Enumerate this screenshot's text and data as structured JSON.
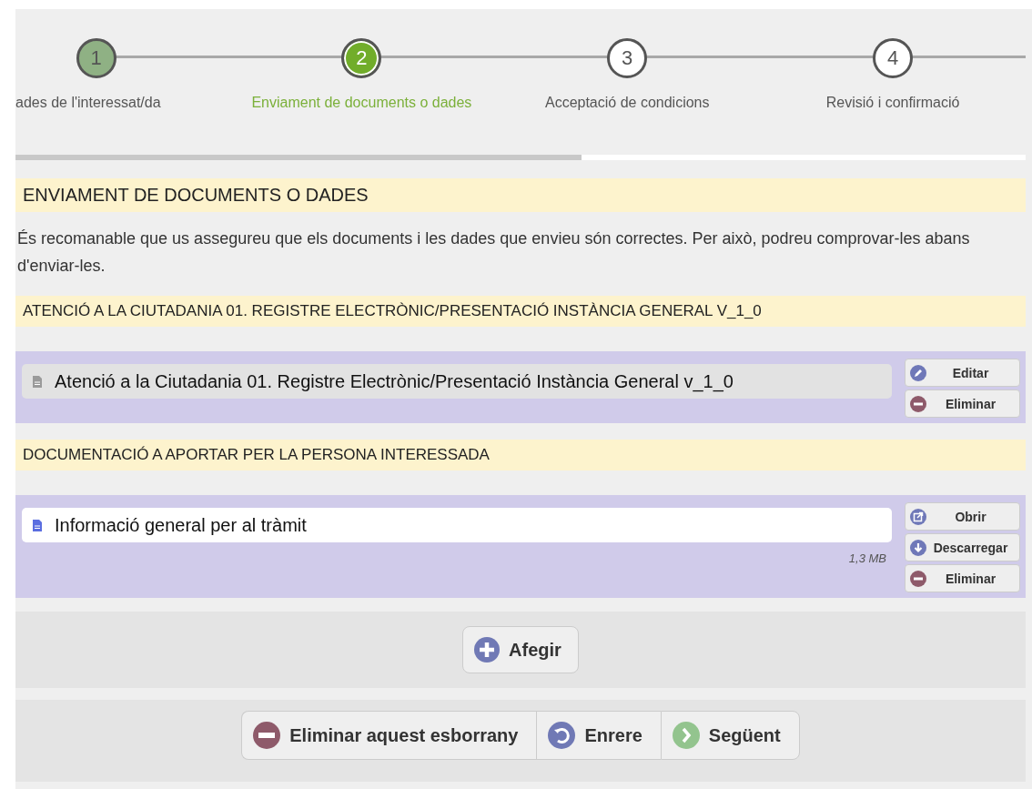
{
  "steps": [
    {
      "number": "1",
      "label": "ades de l'interessat/da",
      "completed": true,
      "selected": false
    },
    {
      "number": "2",
      "label": "Enviament de documents o dades",
      "completed": false,
      "selected": true
    },
    {
      "number": "3",
      "label": "Acceptació de condicions",
      "completed": false,
      "selected": false
    },
    {
      "number": "4",
      "label": "Revisió i confirmació",
      "completed": false,
      "selected": false
    }
  ],
  "progress": {
    "level": 0.56
  },
  "heading": "ENVIAMENT DE DOCUMENTS O DADES",
  "intro": "És recomanable que us assegureu que els documents i les dades que envieu són correctes. Per això, podreu comprovar-les abans d'enviar-les.",
  "sections": [
    {
      "title": "ATENCIÓ A LA CIUTADANIA 01. REGISTRE ELECTRÒNIC/PRESENTACIÓ INSTÀNCIA GENERAL V_1_0",
      "items": [
        {
          "kind": "form",
          "name": "Atenció a la Ciutadania 01. Registre Electrònic/Presentació Instància General v_1_0",
          "actions": [
            {
              "kind": "edit",
              "label": "Editar"
            },
            {
              "kind": "delete",
              "label": "Eliminar"
            }
          ]
        }
      ]
    },
    {
      "title": "DOCUMENTACIÓ A APORTAR PER LA PERSONA INTERESSADA",
      "items": [
        {
          "kind": "file",
          "name": "Informació general per al tràmit",
          "size": "1,3 MB",
          "actions": [
            {
              "kind": "open",
              "label": "Obrir"
            },
            {
              "kind": "download",
              "label": "Descarregar"
            },
            {
              "kind": "delete",
              "label": "Eliminar"
            }
          ]
        }
      ]
    }
  ],
  "add_button": "Afegir",
  "footer_buttons": [
    {
      "kind": "delete",
      "label": "Eliminar aquest esborrany"
    },
    {
      "kind": "back",
      "label": "Enrere"
    },
    {
      "kind": "next",
      "label": "Següent"
    }
  ]
}
